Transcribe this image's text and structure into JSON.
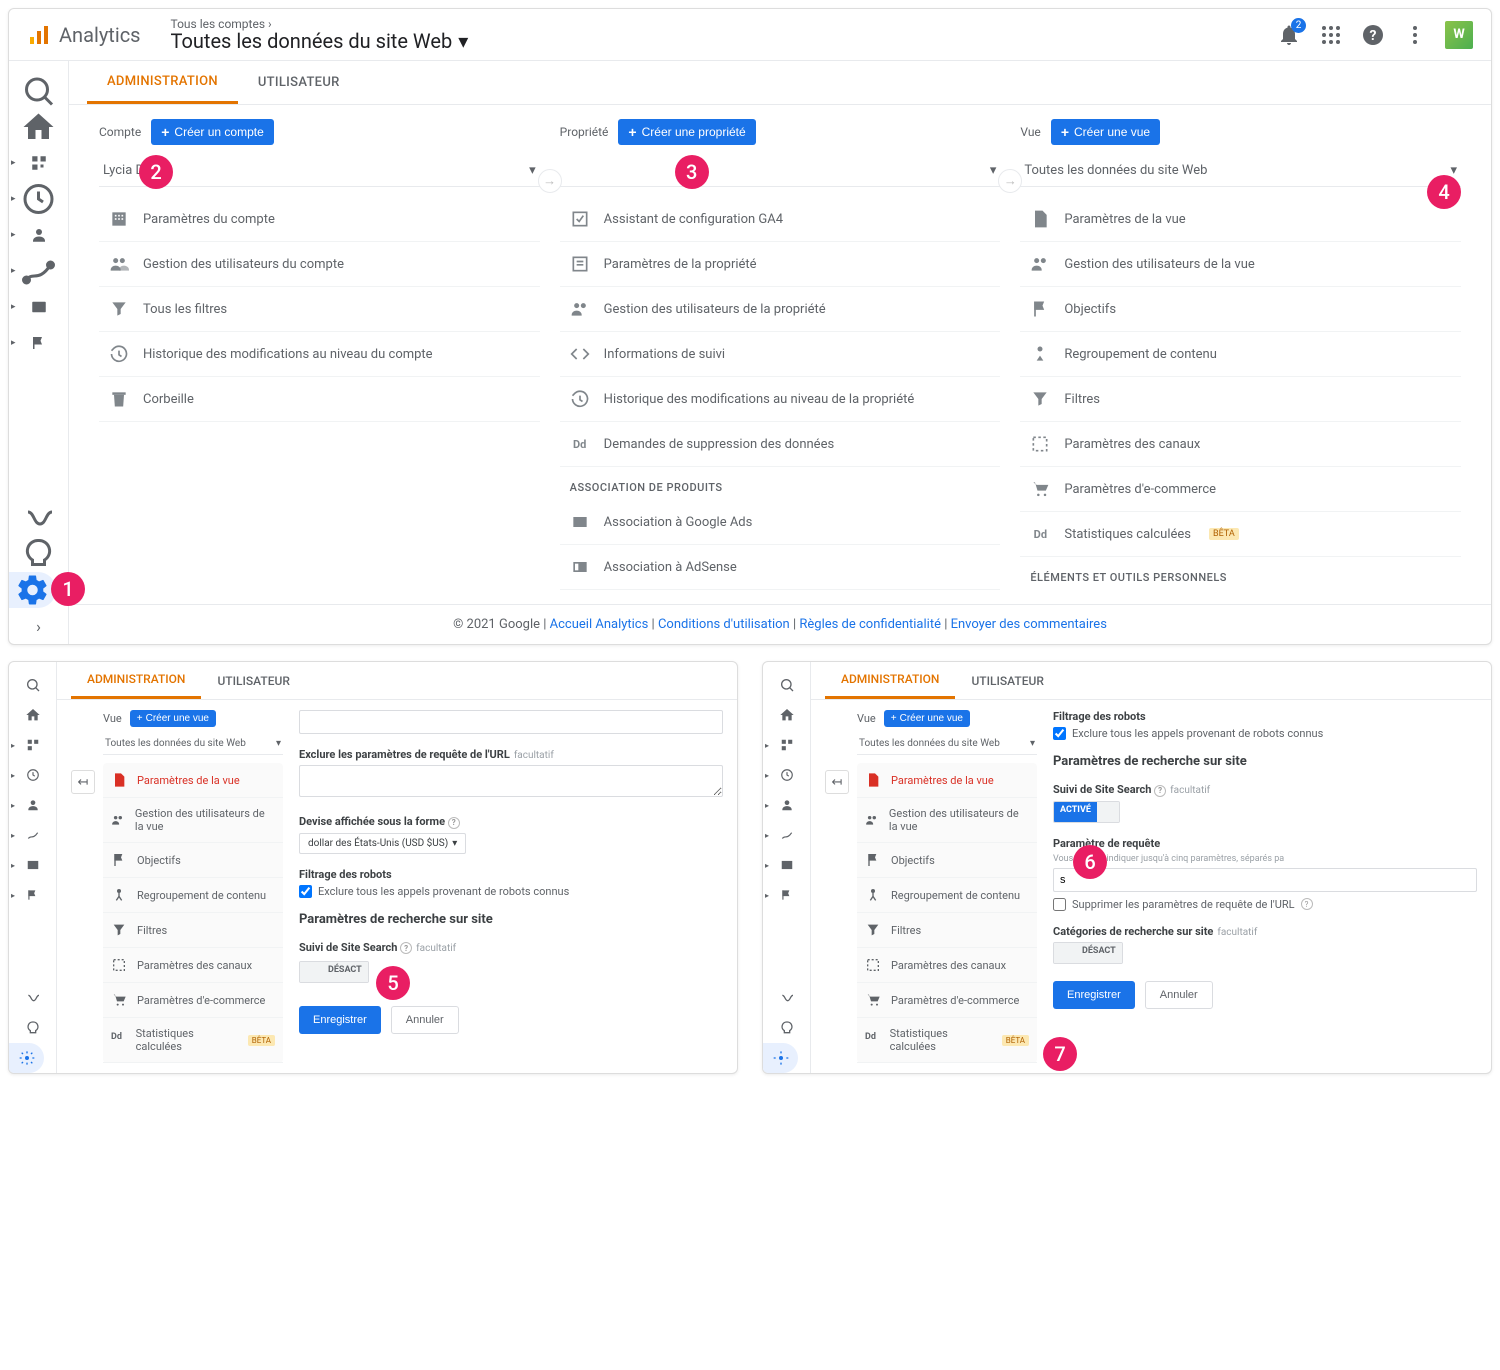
{
  "header": {
    "product": "Analytics",
    "crumb": "Tous les comptes ›",
    "title": "Toutes les données du site Web",
    "notif_count": "2",
    "avatar": "W"
  },
  "tabs": {
    "admin": "ADMINISTRATION",
    "user": "UTILISATEUR"
  },
  "account": {
    "label": "Compte",
    "create": "Créer un compte",
    "selected": "Lycia Diaz",
    "items": [
      "Paramètres du compte",
      "Gestion des utilisateurs du compte",
      "Tous les filtres",
      "Historique des modifications au niveau du compte",
      "Corbeille"
    ]
  },
  "property": {
    "label": "Propriété",
    "create": "Créer une propriété",
    "selected": "",
    "items": [
      "Assistant de configuration GA4",
      "Paramètres de la propriété",
      "Gestion des utilisateurs de la propriété",
      "Informations de suivi",
      "Historique des modifications au niveau de la propriété",
      "Demandes de suppression des données"
    ],
    "assoc_label": "ASSOCIATION DE PRODUITS",
    "assoc": [
      "Association à Google Ads",
      "Association à AdSense"
    ]
  },
  "view": {
    "label": "Vue",
    "create": "Créer une vue",
    "selected": "Toutes les données du site Web",
    "items": [
      "Paramètres de la vue",
      "Gestion des utilisateurs de la vue",
      "Objectifs",
      "Regroupement de contenu",
      "Filtres",
      "Paramètres des canaux",
      "Paramètres d'e-commerce",
      "Statistiques calculées"
    ],
    "beta": "BÊTA",
    "personal_label": "ÉLÉMENTS ET OUTILS PERSONNELS"
  },
  "footer": {
    "copyright": "© 2021 Google | ",
    "links": [
      "Accueil Analytics",
      "Conditions d'utilisation",
      "Règles de confidentialité",
      "Envoyer des commentaires"
    ]
  },
  "settings_panel_a": {
    "exclude_label": "Exclure les paramètres de requête de l'URL",
    "optional": "facultatif",
    "currency_label": "Devise affichée sous la forme",
    "currency_value": "dollar des États-Unis (USD $US)",
    "bot_label": "Filtrage des robots",
    "bot_check": "Exclure tous les appels provenant de robots connus",
    "search_label": "Paramètres de recherche sur site",
    "track_label": "Suivi de Site Search",
    "off": "DÉSACT",
    "save": "Enregistrer",
    "cancel": "Annuler"
  },
  "settings_panel_b": {
    "bot_label": "Filtrage des robots",
    "bot_check": "Exclure tous les appels provenant de robots connus",
    "search_label": "Paramètres de recherche sur site",
    "track_label": "Suivi de Site Search",
    "optional": "facultatif",
    "on": "ACTIVÉ",
    "query_label": "Paramètre de requête",
    "query_hint": "Vous pouvez indiquer jusqu'à cinq paramètres, séparés pa",
    "query_value": "s",
    "strip_label": "Supprimer les paramètres de requête de l'URL",
    "cat_label": "Catégories de recherche sur site",
    "off": "DÉSACT",
    "save": "Enregistrer",
    "cancel": "Annuler"
  },
  "steps": {
    "1": "1",
    "2": "2",
    "3": "3",
    "4": "4",
    "5": "5",
    "6": "6",
    "7": "7"
  }
}
